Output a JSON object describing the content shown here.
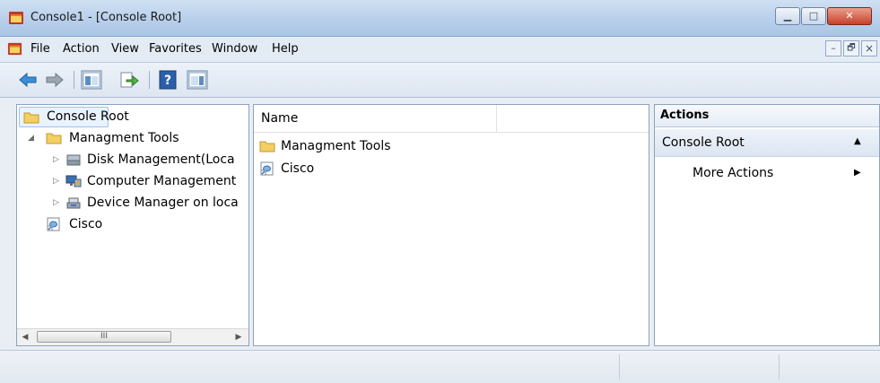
{
  "window": {
    "title": "Console1 - [Console Root]",
    "min_glyph": "▁",
    "max_glyph": "□",
    "close_glyph": "✕"
  },
  "menu": {
    "items": [
      "File",
      "Action",
      "View",
      "Favorites",
      "Window",
      "Help"
    ],
    "mdi_min": "–",
    "mdi_restore": "🗗",
    "mdi_close": "×"
  },
  "toolbar": {
    "buttons": [
      "back-icon",
      "forward-icon",
      "show-hide-console-tree-icon",
      "export-list-icon",
      "help-icon",
      "show-hide-action-pane-icon"
    ]
  },
  "tree": {
    "root": "Console Root",
    "items": [
      {
        "label": "Managment Tools",
        "icon": "folder-icon",
        "expanded": true
      },
      {
        "label": "Disk Management(Loca",
        "icon": "disk-management-icon"
      },
      {
        "label": "Computer Management",
        "icon": "computer-management-icon"
      },
      {
        "label": "Device Manager on loca",
        "icon": "device-manager-icon"
      },
      {
        "label": "Cisco",
        "icon": "link-icon"
      }
    ],
    "scroll_grip": "III"
  },
  "list": {
    "column_name": "Name",
    "rows": [
      {
        "label": "Managment Tools",
        "icon": "folder-icon"
      },
      {
        "label": "Cisco",
        "icon": "link-icon"
      }
    ]
  },
  "actions": {
    "title": "Actions",
    "section": "Console Root",
    "more": "More Actions",
    "section_arrow": "▲",
    "more_arrow": "▶"
  },
  "colors": {
    "selection_bg": "#eaf2fd",
    "selection_border": "#9cc3ec",
    "folder": "#f3cf63"
  }
}
